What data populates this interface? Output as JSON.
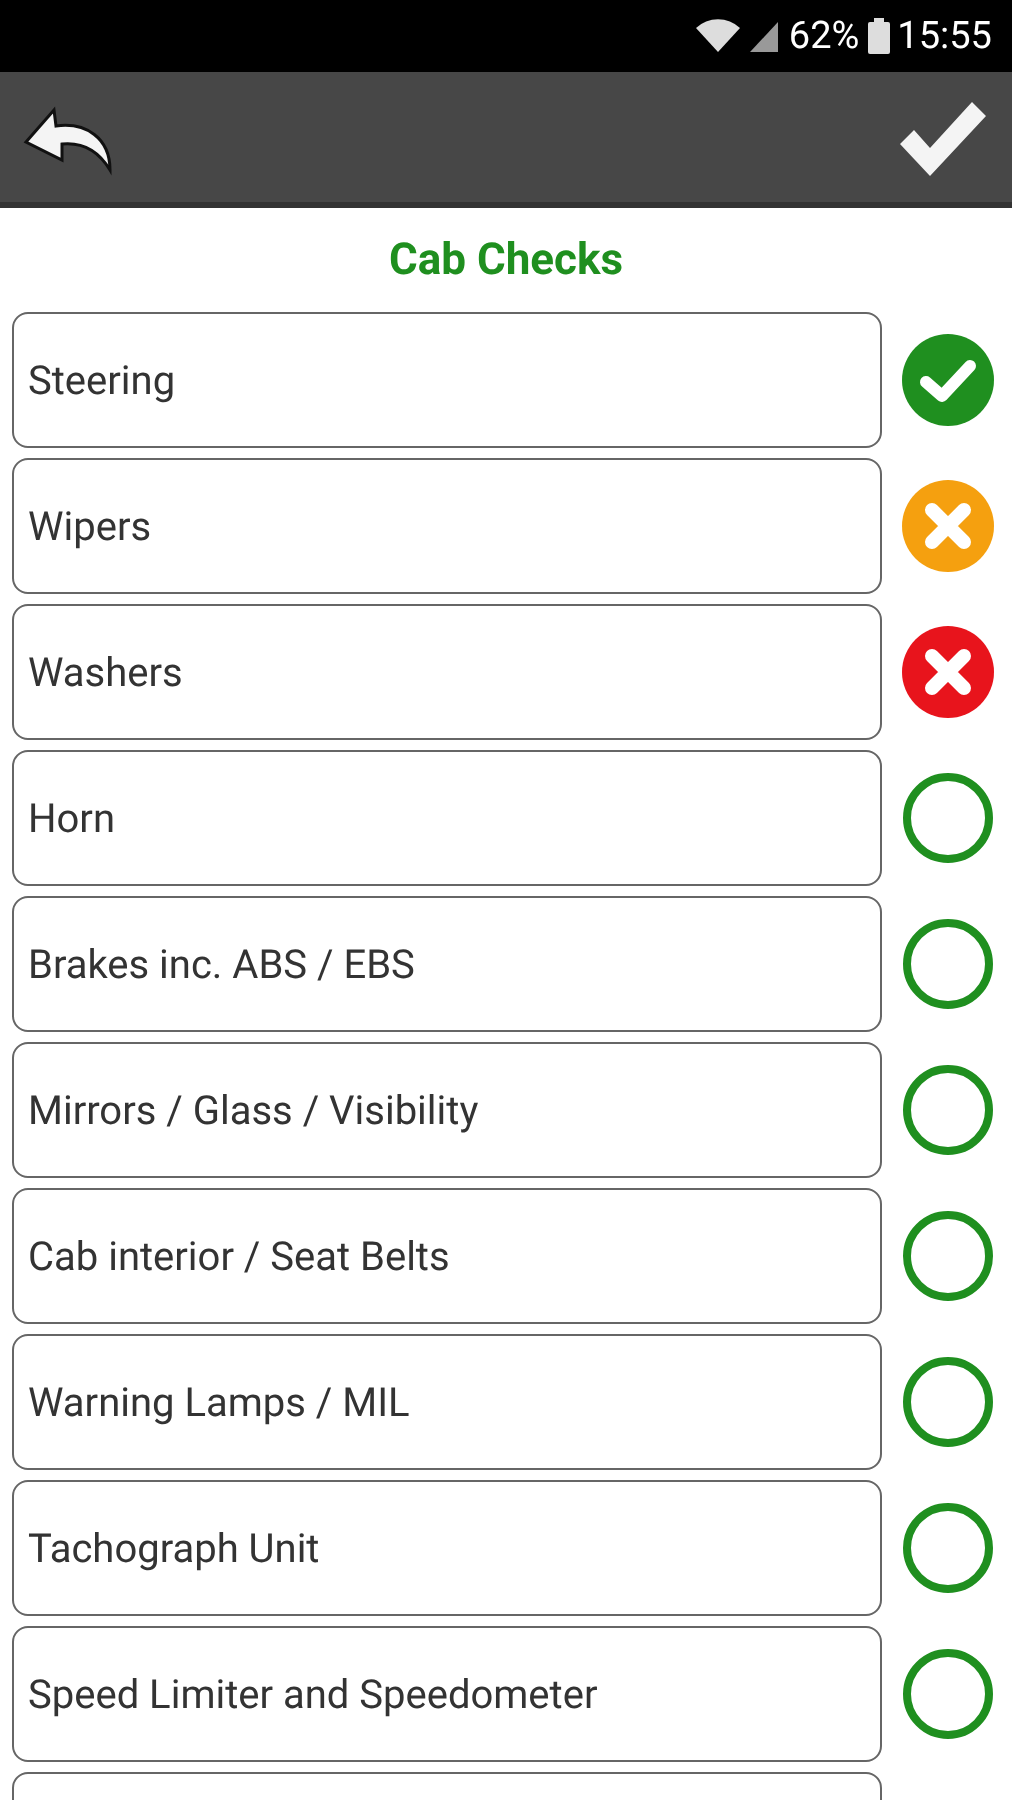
{
  "status_bar": {
    "battery": "62%",
    "time": "15:55"
  },
  "title": "Cab Checks",
  "items": [
    {
      "label": "Steering",
      "kind": "pass"
    },
    {
      "label": "Wipers",
      "kind": "advisory"
    },
    {
      "label": "Washers",
      "kind": "fail"
    },
    {
      "label": "Horn",
      "kind": "unchecked"
    },
    {
      "label": "Brakes inc. ABS / EBS",
      "kind": "unchecked"
    },
    {
      "label": "Mirrors / Glass / Visibility",
      "kind": "unchecked"
    },
    {
      "label": "Cab interior / Seat Belts",
      "kind": "unchecked"
    },
    {
      "label": "Warning Lamps / MIL",
      "kind": "unchecked"
    },
    {
      "label": "Tachograph Unit",
      "kind": "unchecked"
    },
    {
      "label": "Speed Limiter and Speedometer",
      "kind": "unchecked"
    }
  ]
}
